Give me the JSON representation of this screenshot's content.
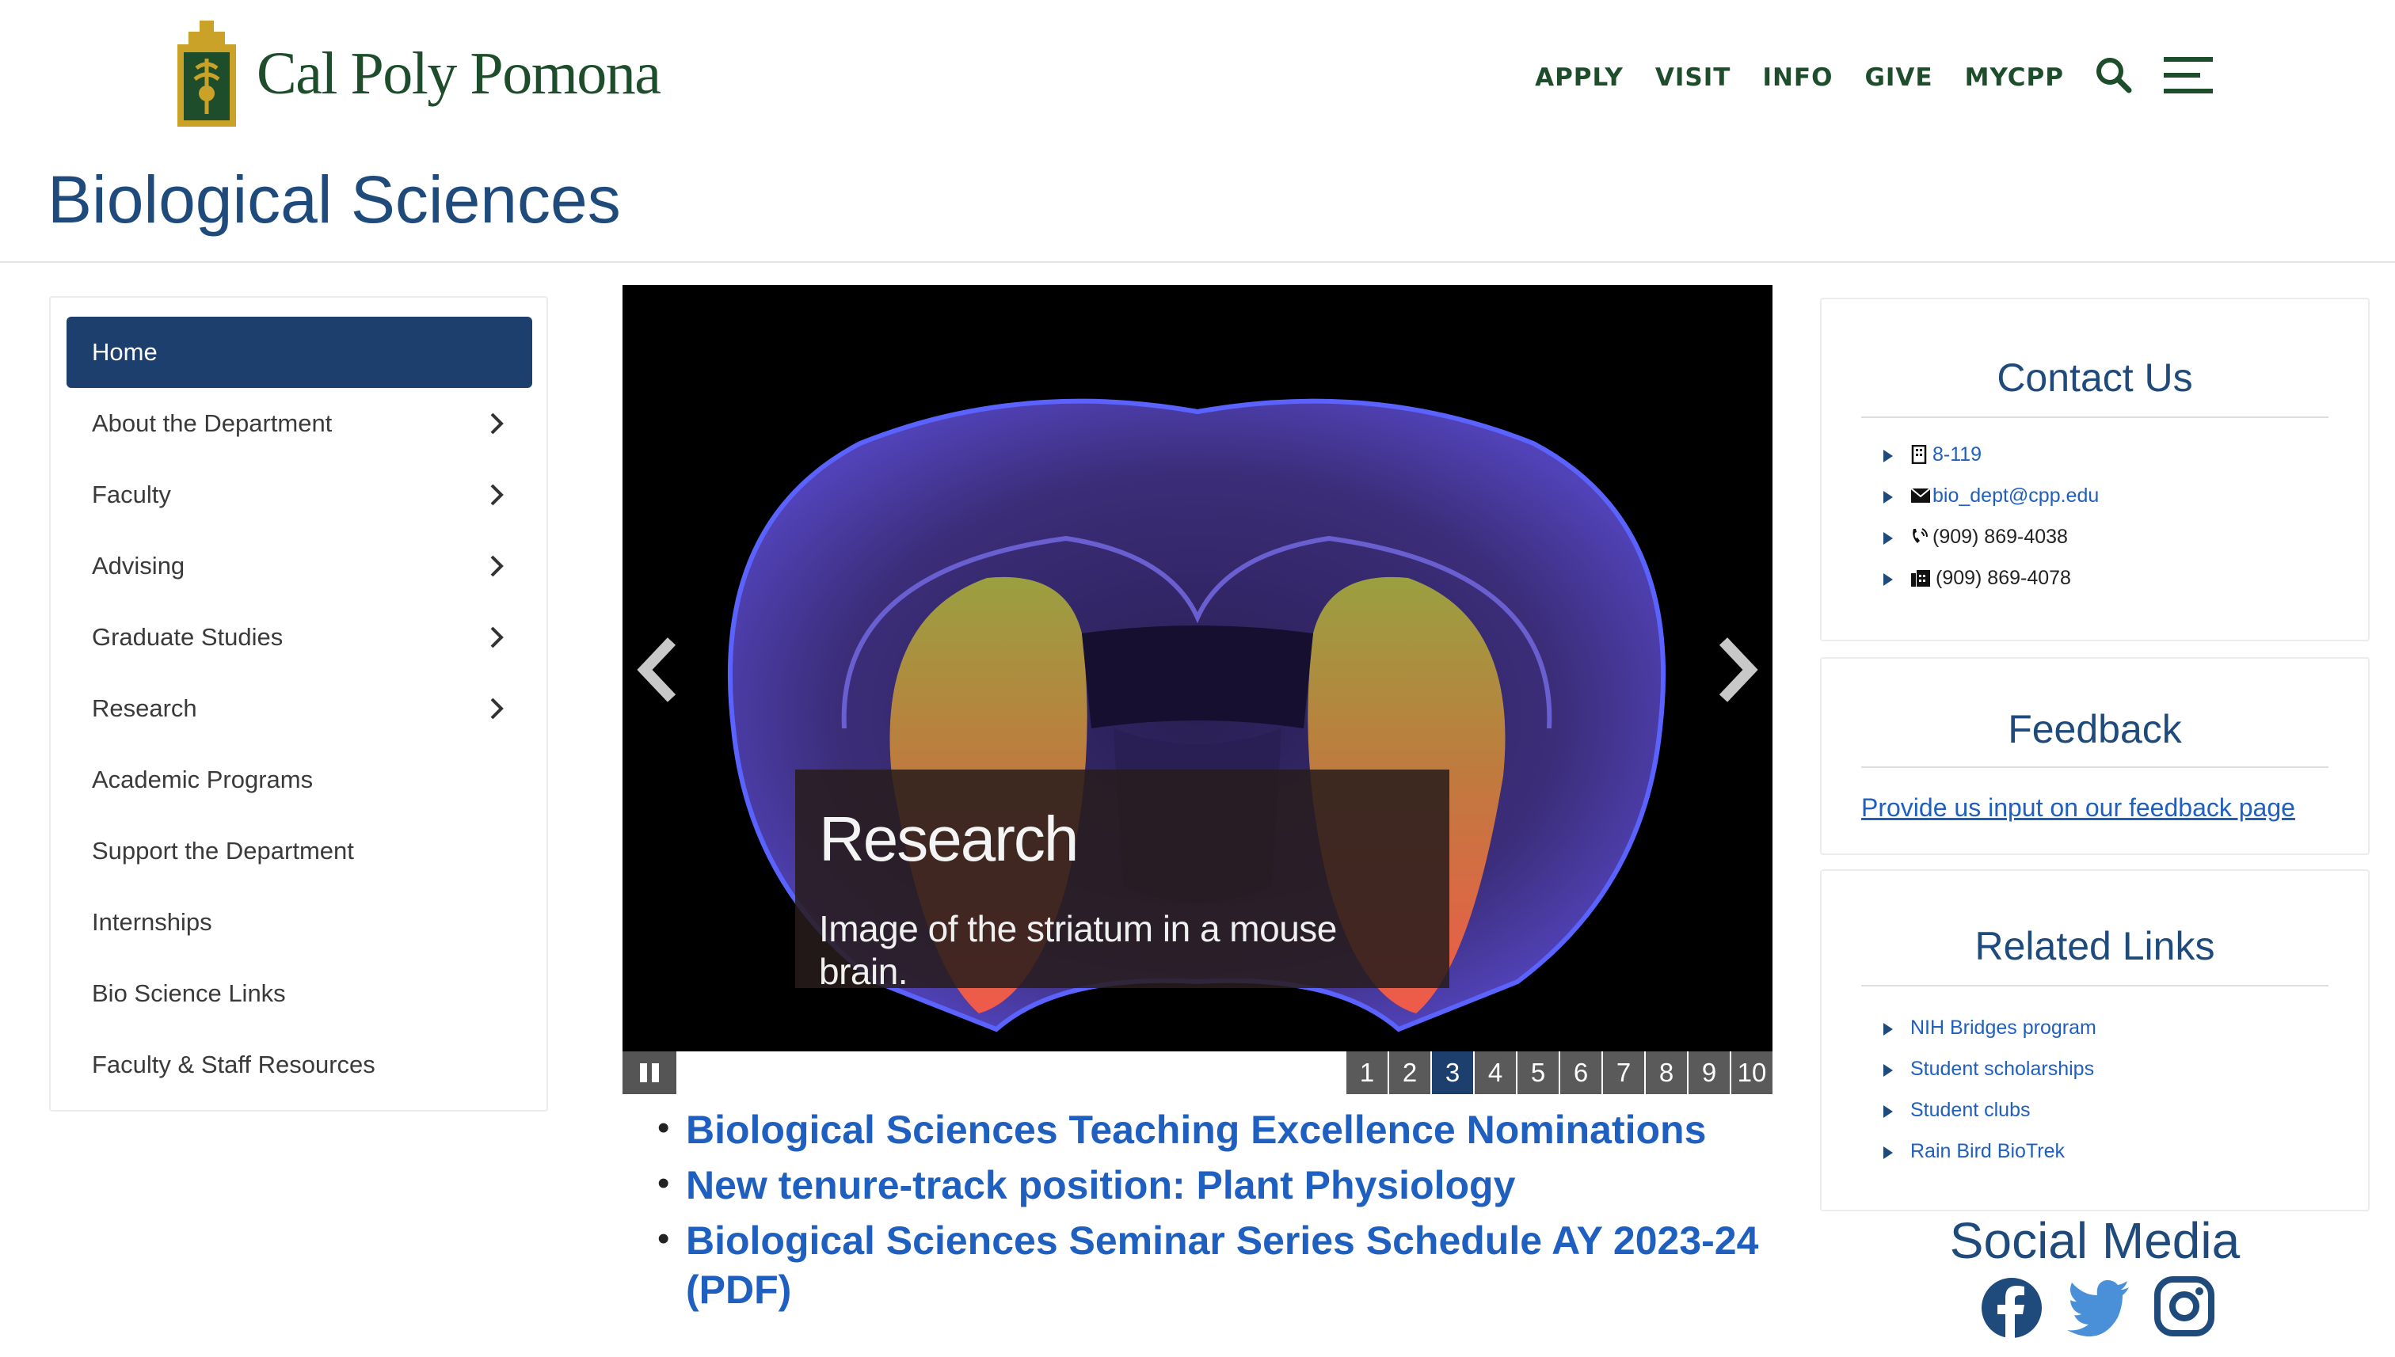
{
  "header": {
    "logo_text": "Cal Poly Pomona",
    "nav": [
      "APPLY",
      "VISIT",
      "INFO",
      "GIVE",
      "MYCPP"
    ],
    "page_title": "Biological Sciences"
  },
  "sidenav": {
    "items": [
      {
        "label": "Home",
        "active": true,
        "has_submenu": false
      },
      {
        "label": "About the Department",
        "active": false,
        "has_submenu": true
      },
      {
        "label": "Faculty",
        "active": false,
        "has_submenu": true
      },
      {
        "label": "Advising",
        "active": false,
        "has_submenu": true
      },
      {
        "label": "Graduate Studies",
        "active": false,
        "has_submenu": true
      },
      {
        "label": "Research",
        "active": false,
        "has_submenu": true
      },
      {
        "label": "Academic Programs",
        "active": false,
        "has_submenu": false
      },
      {
        "label": "Support the Department",
        "active": false,
        "has_submenu": false
      },
      {
        "label": "Internships",
        "active": false,
        "has_submenu": false
      },
      {
        "label": "Bio Science Links",
        "active": false,
        "has_submenu": false
      },
      {
        "label": "Faculty & Staff Resources",
        "active": false,
        "has_submenu": false
      }
    ]
  },
  "slider": {
    "caption_title": "Research",
    "caption_text": "Image of the striatum in a mouse brain.",
    "pages": [
      "1",
      "2",
      "3",
      "4",
      "5",
      "6",
      "7",
      "8",
      "9",
      "10"
    ],
    "active_page": "3"
  },
  "news": [
    "Biological Sciences Teaching Excellence Nominations",
    "New tenure-track position: Plant Physiology",
    "Biological Sciences Seminar Series Schedule AY 2023-24 (PDF)"
  ],
  "contact": {
    "title": "Contact Us",
    "room": "8-119",
    "email": "bio_dept@cpp.edu",
    "phone": "(909) 869-4038",
    "fax": "(909) 869-4078"
  },
  "feedback": {
    "title": "Feedback",
    "link": "Provide us input on our feedback page"
  },
  "related": {
    "title": "Related Links",
    "links": [
      "NIH Bridges program",
      "Student scholarships",
      "Student clubs",
      "Rain Bird BioTrek"
    ]
  },
  "social": {
    "title": "Social Media",
    "icons": [
      "facebook-icon",
      "twitter-icon",
      "instagram-icon"
    ]
  },
  "colors": {
    "brand_green": "#1e4d2b",
    "title_blue": "#1f4a7c",
    "link_blue": "#1f5fbf",
    "nav_active": "#1c3f6e"
  }
}
